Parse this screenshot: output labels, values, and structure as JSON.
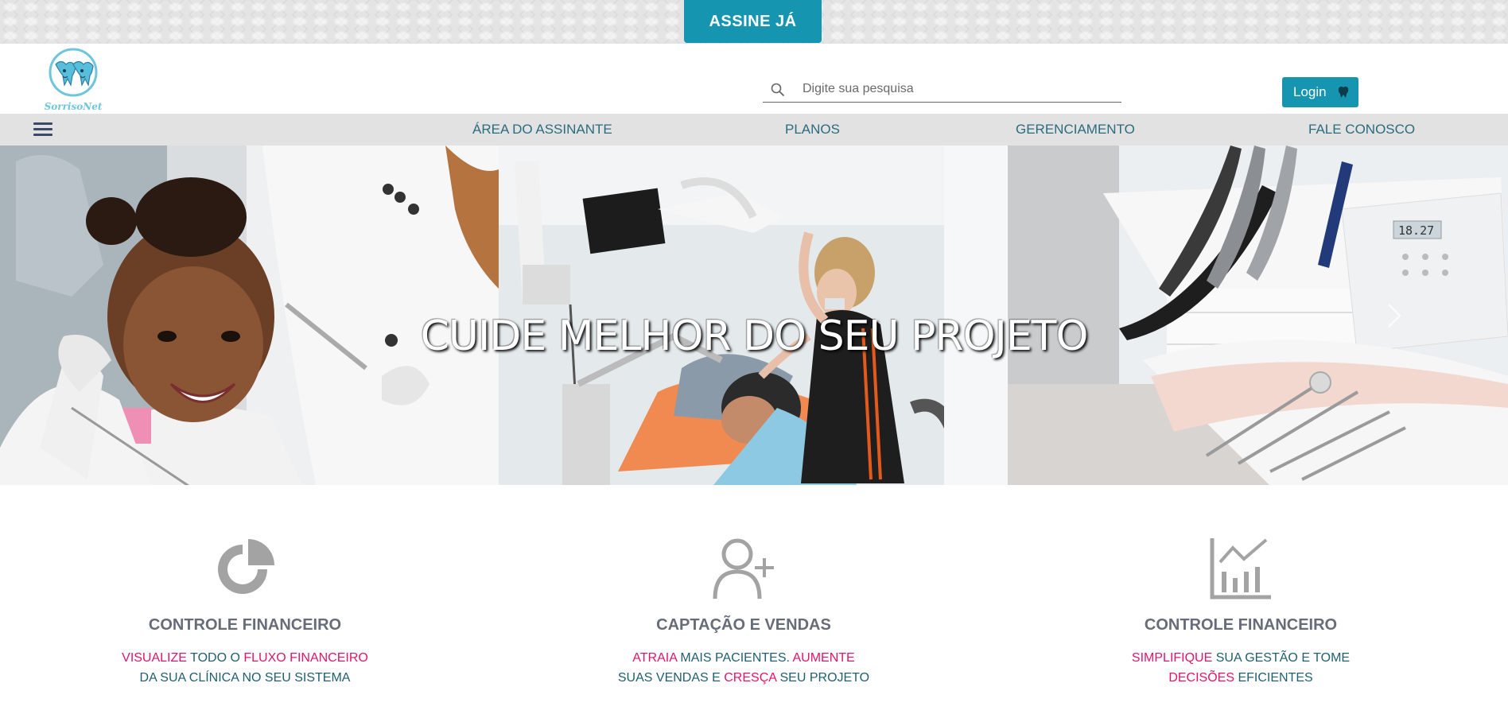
{
  "topbar": {
    "cta_label": "ASSINE JÁ"
  },
  "header": {
    "logo_text": "SorrisoNet",
    "search_placeholder": "Digite sua pesquisa",
    "login_label": "Login"
  },
  "nav": {
    "items": [
      {
        "label": "ÁREA DO ASSINANTE"
      },
      {
        "label": "PLANOS"
      },
      {
        "label": "GERENCIAMENTO"
      },
      {
        "label": "FALE CONOSCO"
      }
    ]
  },
  "hero": {
    "title": "CUIDE MELHOR DO SEU PROJETO"
  },
  "features": [
    {
      "icon": "pie-chart-icon",
      "title": "CONTROLE FINANCEIRO",
      "line1": [
        {
          "t": "VISUALIZE",
          "h": true
        },
        {
          "t": " TODO O ",
          "h": false
        },
        {
          "t": "FLUXO FINANCEIRO",
          "h": true
        }
      ],
      "line2": [
        {
          "t": "DA SUA CLÍNICA NO SEU SISTEMA",
          "h": false
        }
      ]
    },
    {
      "icon": "add-user-icon",
      "title": "CAPTAÇÃO E VENDAS",
      "line1": [
        {
          "t": "ATRAIA",
          "h": true
        },
        {
          "t": " MAIS PACIENTES. ",
          "h": false
        },
        {
          "t": "AUMENTE",
          "h": true
        }
      ],
      "line2": [
        {
          "t": "SUAS VENDAS E ",
          "h": false
        },
        {
          "t": "CRESÇA",
          "h": true
        },
        {
          "t": " SEU PROJETO",
          "h": false
        }
      ]
    },
    {
      "icon": "bar-chart-icon",
      "title": "CONTROLE FINANCEIRO",
      "line1": [
        {
          "t": "SIMPLIFIQUE",
          "h": true
        },
        {
          "t": " SUA GESTÃO E TOME",
          "h": false
        }
      ],
      "line2": [
        {
          "t": "DECISÕES",
          "h": true
        },
        {
          "t": " EFICIENTES",
          "h": false
        }
      ]
    }
  ],
  "colors": {
    "brand": "#1595b0",
    "accent": "#e3146b",
    "nav_text": "#2b6c7c"
  }
}
